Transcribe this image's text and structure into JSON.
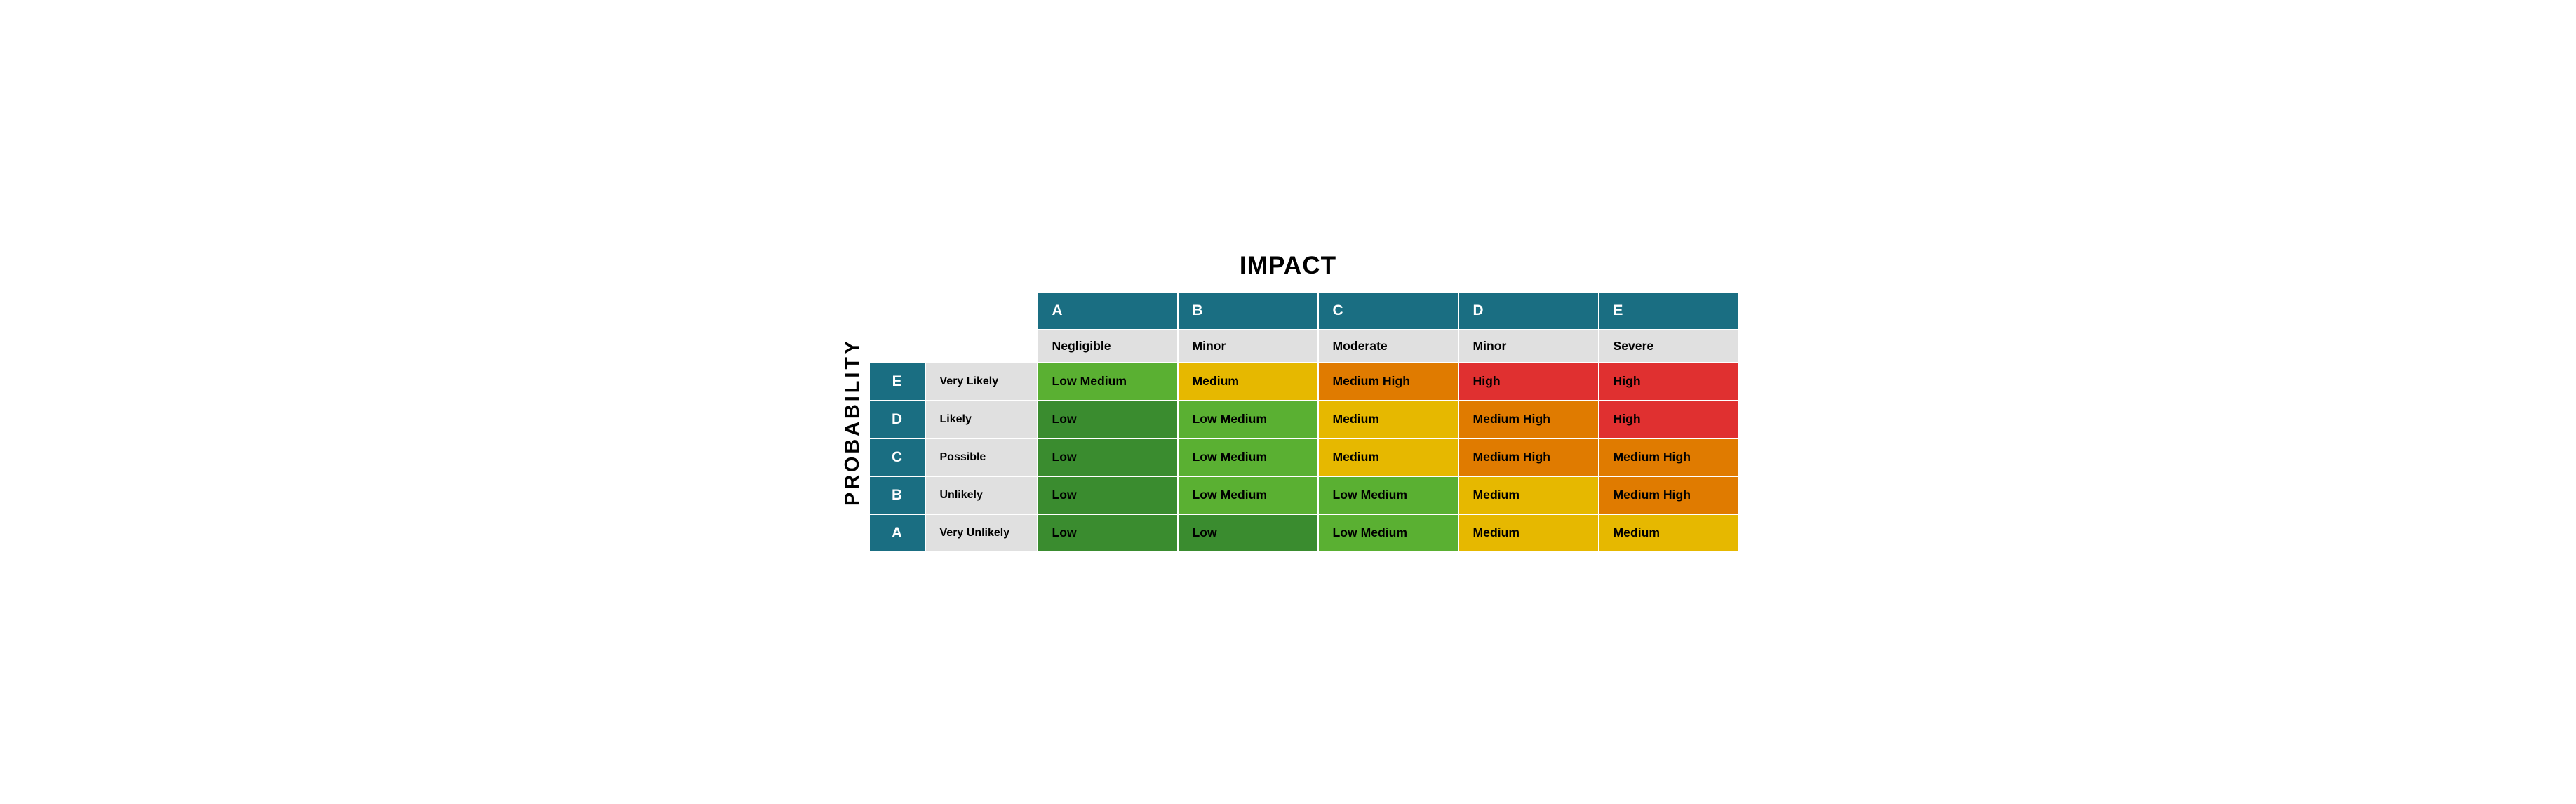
{
  "title": "IMPACT",
  "probability_label": "PROBABILITY",
  "columns": {
    "headers": [
      "A",
      "B",
      "C",
      "D",
      "E"
    ],
    "subheaders": [
      "Negligible",
      "Minor",
      "Moderate",
      "Minor",
      "Severe"
    ]
  },
  "rows": [
    {
      "letter": "E",
      "description": "Very Likely",
      "cells": [
        {
          "label": "Low Medium",
          "class": "low-medium"
        },
        {
          "label": "Medium",
          "class": "medium"
        },
        {
          "label": "Medium High",
          "class": "medium-high"
        },
        {
          "label": "High",
          "class": "high"
        },
        {
          "label": "High",
          "class": "high"
        }
      ]
    },
    {
      "letter": "D",
      "description": "Likely",
      "cells": [
        {
          "label": "Low",
          "class": "low"
        },
        {
          "label": "Low Medium",
          "class": "low-medium"
        },
        {
          "label": "Medium",
          "class": "medium"
        },
        {
          "label": "Medium High",
          "class": "medium-high"
        },
        {
          "label": "High",
          "class": "high"
        }
      ]
    },
    {
      "letter": "C",
      "description": "Possible",
      "cells": [
        {
          "label": "Low",
          "class": "low"
        },
        {
          "label": "Low Medium",
          "class": "low-medium"
        },
        {
          "label": "Medium",
          "class": "medium"
        },
        {
          "label": "Medium High",
          "class": "medium-high"
        },
        {
          "label": "Medium High",
          "class": "medium-high"
        }
      ]
    },
    {
      "letter": "B",
      "description": "Unlikely",
      "cells": [
        {
          "label": "Low",
          "class": "low"
        },
        {
          "label": "Low Medium",
          "class": "low-medium"
        },
        {
          "label": "Low Medium",
          "class": "low-medium"
        },
        {
          "label": "Medium",
          "class": "medium"
        },
        {
          "label": "Medium High",
          "class": "medium-high"
        }
      ]
    },
    {
      "letter": "A",
      "description": "Very Unlikely",
      "cells": [
        {
          "label": "Low",
          "class": "low"
        },
        {
          "label": "Low",
          "class": "low"
        },
        {
          "label": "Low Medium",
          "class": "low-medium"
        },
        {
          "label": "Medium",
          "class": "medium"
        },
        {
          "label": "Medium",
          "class": "medium"
        }
      ]
    }
  ]
}
